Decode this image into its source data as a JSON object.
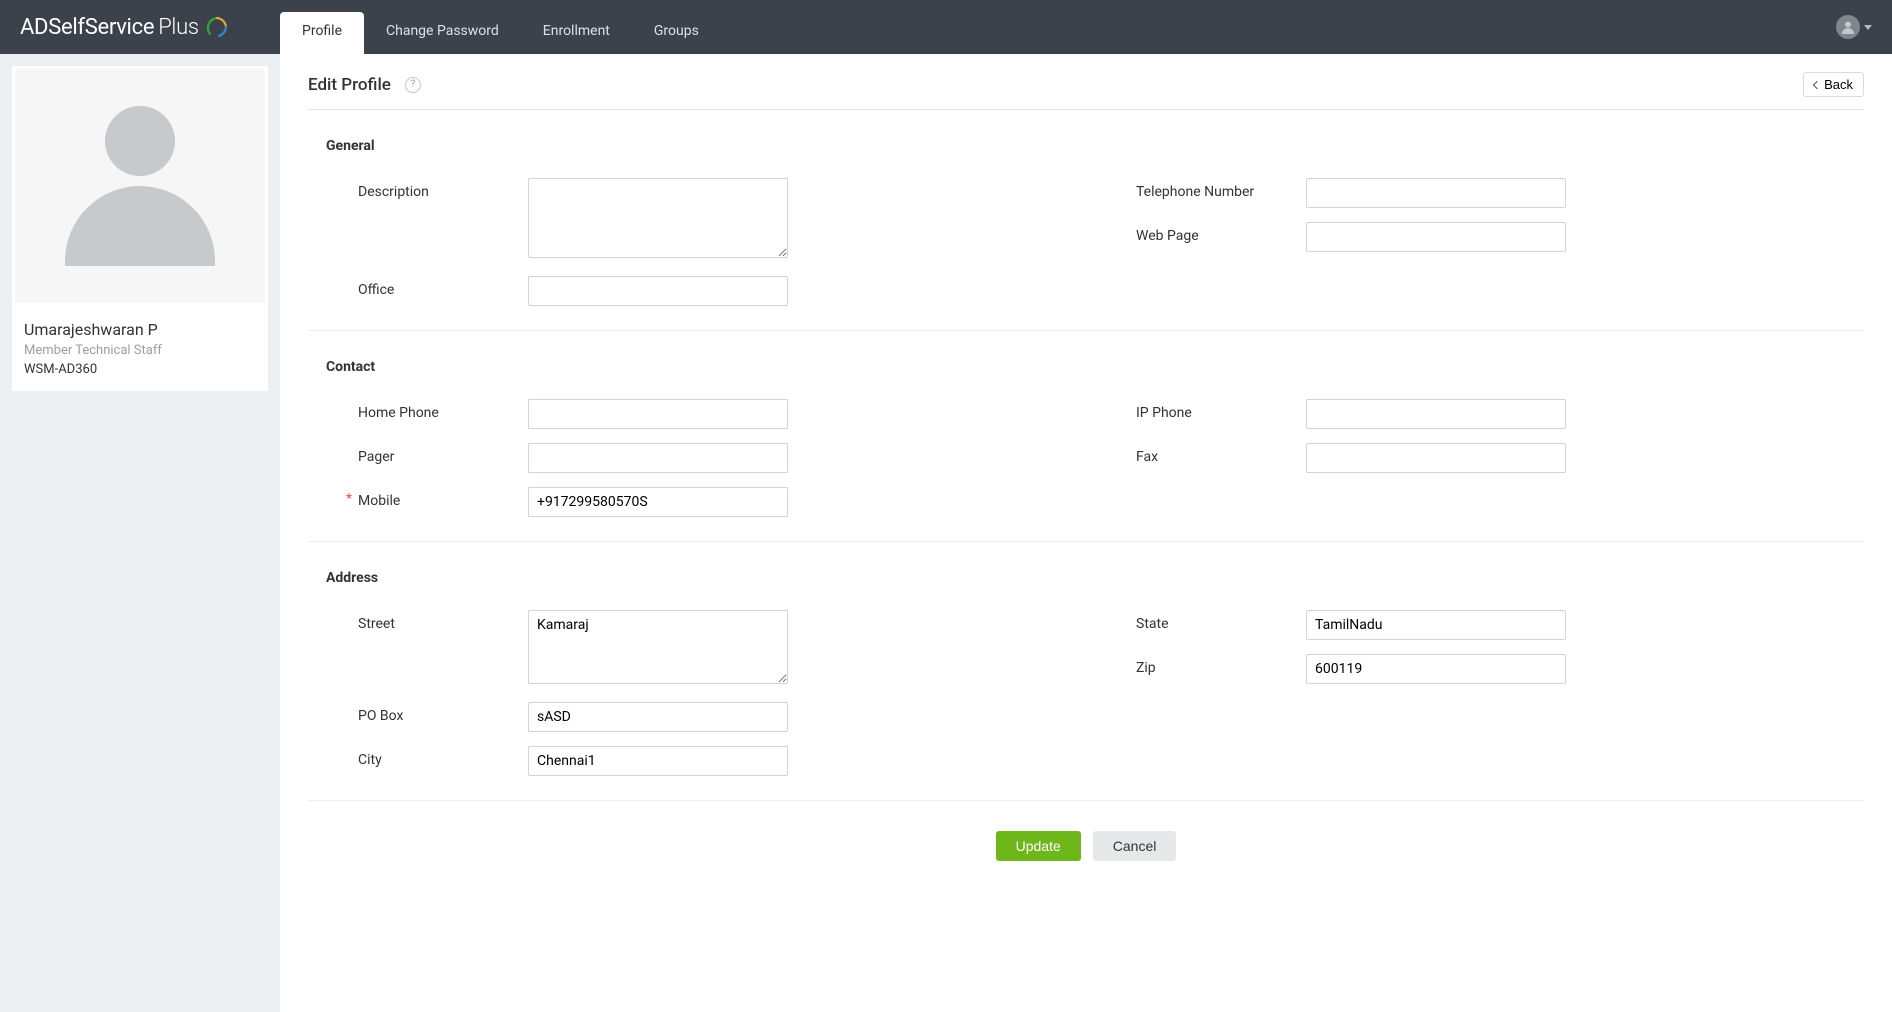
{
  "app": {
    "logo_text": "ADSelfService",
    "logo_plus": "Plus"
  },
  "tabs": [
    {
      "label": "Profile"
    },
    {
      "label": "Change Password"
    },
    {
      "label": "Enrollment"
    },
    {
      "label": "Groups"
    }
  ],
  "profile_card": {
    "name": "Umarajeshwaran P",
    "role": "Member Technical Staff",
    "org": "WSM-AD360"
  },
  "page": {
    "title": "Edit Profile",
    "back_label": "Back"
  },
  "sections": {
    "general": {
      "title": "General",
      "fields": {
        "description_label": "Description",
        "description_value": "",
        "office_label": "Office",
        "office_value": "",
        "telephone_label": "Telephone Number",
        "telephone_value": "",
        "webpage_label": "Web Page",
        "webpage_value": ""
      }
    },
    "contact": {
      "title": "Contact",
      "fields": {
        "homephone_label": "Home Phone",
        "homephone_value": "",
        "pager_label": "Pager",
        "pager_value": "",
        "mobile_label": "Mobile",
        "mobile_value": "+917299580570S",
        "ipphone_label": "IP Phone",
        "ipphone_value": "",
        "fax_label": "Fax",
        "fax_value": ""
      }
    },
    "address": {
      "title": "Address",
      "fields": {
        "street_label": "Street",
        "street_value": "Kamaraj",
        "pobox_label": "PO Box",
        "pobox_value": "sASD",
        "city_label": "City",
        "city_value": "Chennai1",
        "state_label": "State",
        "state_value": "TamilNadu",
        "zip_label": "Zip",
        "zip_value": "600119"
      }
    }
  },
  "actions": {
    "update_label": "Update",
    "cancel_label": "Cancel"
  },
  "help_icon_text": "?"
}
